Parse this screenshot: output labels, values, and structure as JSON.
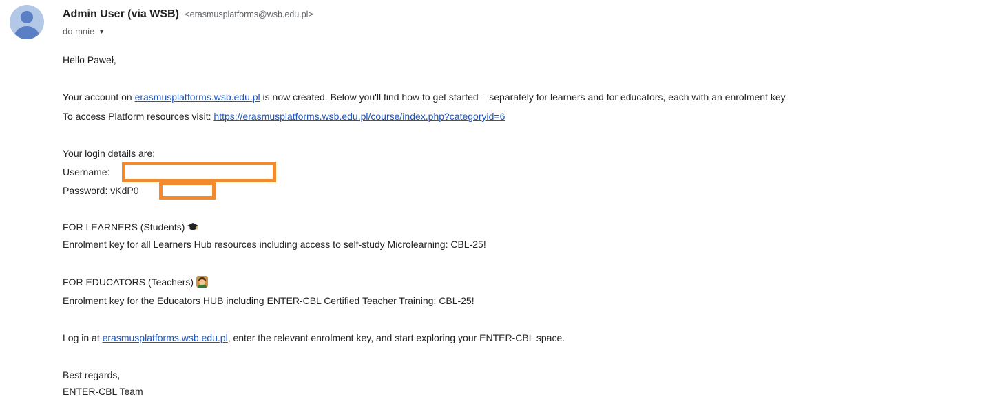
{
  "header": {
    "sender_name": "Admin User (via WSB)",
    "sender_email": "<erasmusplatforms@wsb.edu.pl>",
    "to_label": "do mnie",
    "caret_icon": "caret-down-icon"
  },
  "email": {
    "greeting": "Hello Paweł,",
    "intro_prefix": "Your account on ",
    "intro_link": "erasmusplatforms.wsb.edu.pl",
    "intro_suffix": " is now created. Below you'll find how to get started – separately for learners and for educators, each with an enrolment key.",
    "access_prefix": "To access Platform resources visit: ",
    "access_link": "https://erasmusplatforms.wsb.edu.pl/course/index.php?categoryid=6",
    "login_intro": "Your login details are:",
    "username_label": "Username:",
    "password_label": "Password: vKdP0",
    "learners_heading": "FOR LEARNERS (Students)",
    "learners_key": "Enrolment key for all Learners Hub resources including access to self-study Microlearning: CBL-25!",
    "educators_heading": "FOR EDUCATORS (Teachers)",
    "educators_key": "Enrolment key for the Educators HUB including ENTER-CBL Certified Teacher Training: CBL-25!",
    "login_prefix": "Log in at ",
    "login_link": "erasmusplatforms.wsb.edu.pl",
    "login_suffix": ", enter the relevant enrolment key, and start exploring your ENTER-CBL space.",
    "regards": "Best regards,",
    "team": "ENTER-CBL Team"
  },
  "colors": {
    "link": "#1a55c4",
    "redaction": "#f28a2e",
    "avatar_bg": "#b3c7e6",
    "avatar_fg": "#5b7fc4"
  }
}
